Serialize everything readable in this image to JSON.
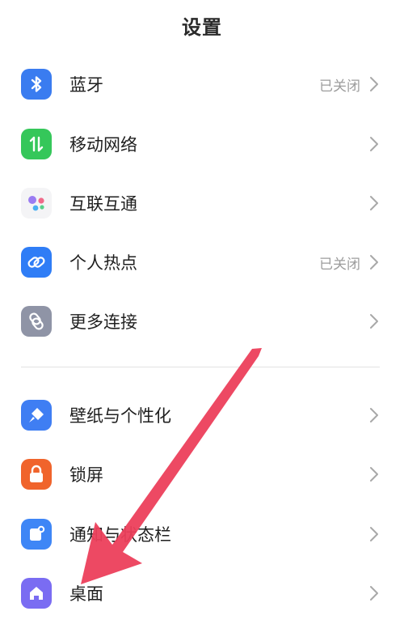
{
  "header": {
    "title": "设置"
  },
  "colors": {
    "bluetooth": "#3a7cf0",
    "mobile_network": "#35c75a",
    "hotspot": "#2f7df6",
    "more_connections": "#8f94a6",
    "wallpaper": "#3f7ef3",
    "lockscreen": "#f0642c",
    "notifications": "#3e86f6",
    "desktop": "#7a6cf2",
    "annotation_arrow": "#ec3f5b"
  },
  "groups": [
    {
      "items": [
        {
          "label": "蓝牙",
          "status": "已关闭",
          "icon": "bluetooth-icon"
        },
        {
          "label": "移动网络",
          "status": "",
          "icon": "mobile-network-icon"
        },
        {
          "label": "互联互通",
          "status": "",
          "icon": "interconnect-icon"
        },
        {
          "label": "个人热点",
          "status": "已关闭",
          "icon": "hotspot-icon"
        },
        {
          "label": "更多连接",
          "status": "",
          "icon": "more-connections-icon"
        }
      ]
    },
    {
      "items": [
        {
          "label": "壁纸与个性化",
          "status": "",
          "icon": "wallpaper-icon"
        },
        {
          "label": "锁屏",
          "status": "",
          "icon": "lock-icon"
        },
        {
          "label": "通知与状态栏",
          "status": "",
          "icon": "notification-icon"
        },
        {
          "label": "桌面",
          "status": "",
          "icon": "home-icon"
        }
      ]
    }
  ]
}
